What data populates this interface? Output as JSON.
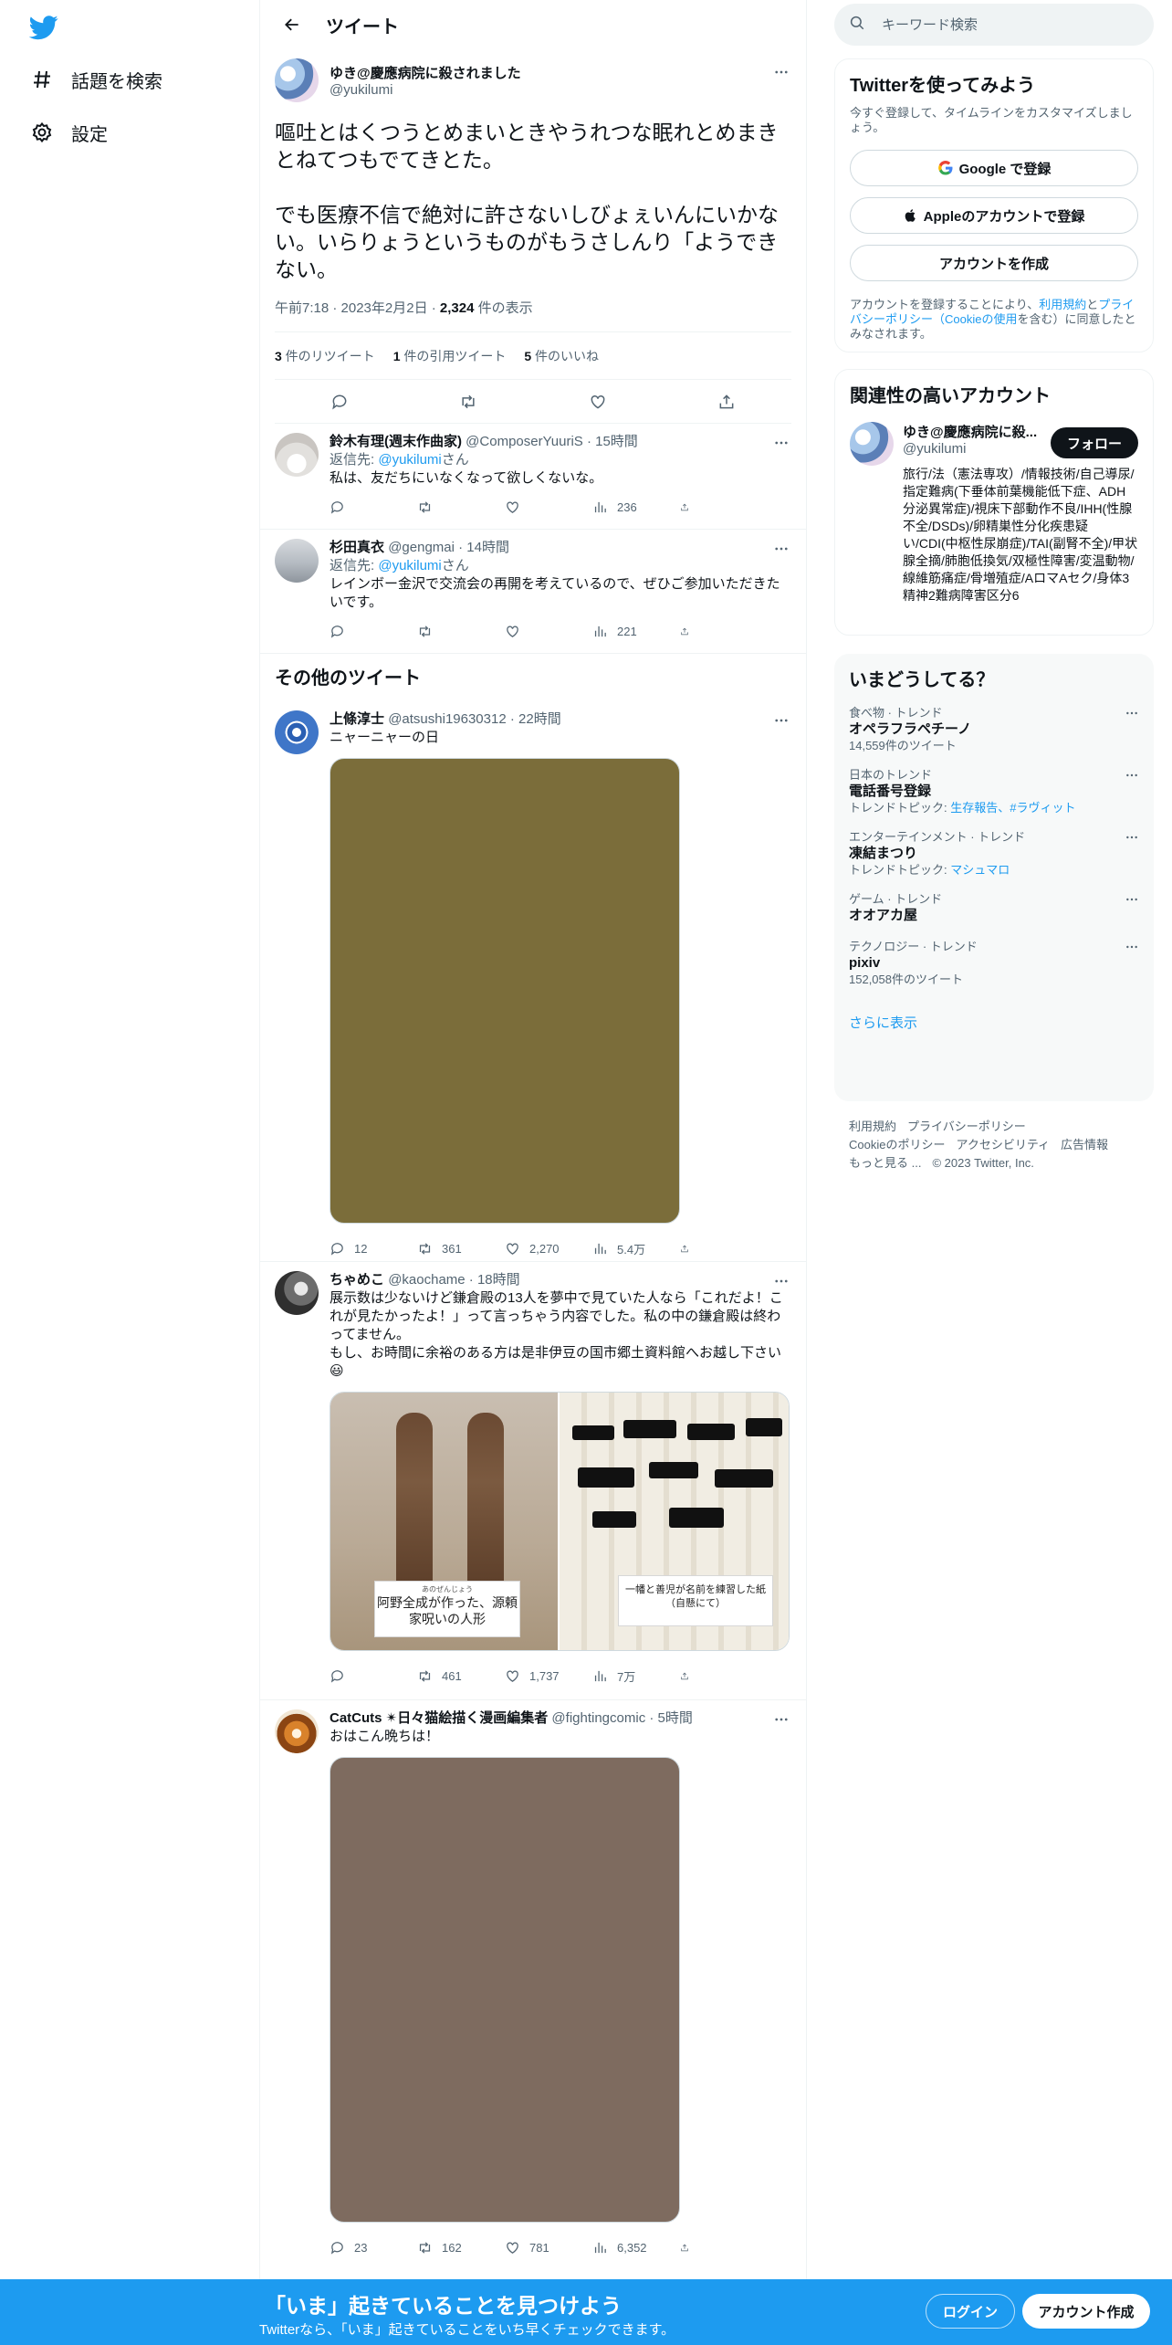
{
  "nav": {
    "explore_label": "話題を検索",
    "settings_label": "設定"
  },
  "header": {
    "title": "ツイート"
  },
  "focus_tweet": {
    "display_name": "ゆき@慶應病院に殺されました",
    "handle": "@yukilumi",
    "text": "嘔吐とはくつうとめまいときやうれつな眠れとめまきとねてつもでてきとた。\n\nでも医療不信で絶対に許さないしびょぇいんにいかない。いらりょうというものがもうさしんり「ようできない。",
    "time": "午前7:18 · 2023年2月2日 · ",
    "views": "2,324",
    "views_label": " 件の表示",
    "retweets": "3",
    "retweets_label": " 件のリツイート",
    "quotes": "1",
    "quotes_label": " 件の引用ツイート",
    "likes": "5",
    "likes_label": " 件のいいね"
  },
  "replies": [
    {
      "display_name": "鈴木有理(週末作曲家)",
      "handle_time": "@ComposerYuuriS · 15時間",
      "reply_prefix": "返信先: ",
      "reply_to": "@yukilumi",
      "reply_suffix": "さん",
      "text": "私は、友だちにいなくなって欲しくないな。",
      "views": "236"
    },
    {
      "display_name": "杉田真衣",
      "handle_time": "@gengmai · 14時間",
      "reply_prefix": "返信先: ",
      "reply_to": "@yukilumi",
      "reply_suffix": "さん",
      "text": "レインボー金沢で交流会の再開を考えているので、ぜひご参加いただきたいです。",
      "views": "221"
    }
  ],
  "more_tweets_title": "その他のツイート",
  "more_tweets": [
    {
      "display_name": "上條淳士",
      "handle_time": "@atsushi19630312 · 22時間",
      "text": "ニャーニャーの日",
      "media_color": "#7b6d3a",
      "replies": "12",
      "retweets": "361",
      "likes": "2,270",
      "views": "5.4万"
    },
    {
      "display_name": "ちゃめこ",
      "handle_time": "@kaochame · 18時間",
      "text": "展示数は少ないけど鎌倉殿の13人を夢中で見ていた人なら「これだよ！これが見たかったよ！」って言っちゃう内容でした。私の中の鎌倉殿は終わってません。\nもし、お時間に余裕のある方は是非伊豆の国市郷土資料館へお越し下さい😃",
      "caption_left_ruby": "あのぜんじょう",
      "caption_left": "阿野全成が作った、源頼家呪いの人形",
      "caption_right_small": "一幡と善児が名前を練習した紙",
      "caption_right": "（自懸にて）",
      "replies": "",
      "retweets": "461",
      "likes": "1,737",
      "views": "7万"
    },
    {
      "display_name": "CatCuts ✴日々猫絵描く漫画編集者",
      "handle_time": "@fightingcomic · 5時間",
      "text": "おはこん晩ちは！",
      "media_color": "#7e6b5f",
      "replies": "23",
      "retweets": "162",
      "likes": "781",
      "views": "6,352"
    }
  ],
  "search": {
    "placeholder": "キーワード検索"
  },
  "signup_card": {
    "title": "Twitterを使ってみよう",
    "desc": "今すぐ登録して、タイムラインをカスタマイズしましょう。",
    "google": "Google で登録",
    "apple": "Appleのアカウントで登録",
    "create": "アカウントを作成",
    "terms_pre": "アカウントを登録することにより、",
    "terms_link1": "利用規約",
    "terms_mid": "と",
    "terms_link2": "プライバシーポリシー（Cookieの使用",
    "terms_post": "を含む）に同意したとみなされます。"
  },
  "related": {
    "title": "関連性の高いアカウント",
    "display_name": "ゆき@慶應病院に殺...",
    "handle": "@yukilumi",
    "follow": "フォロー",
    "bio": "旅行/法（憲法専攻）/情報技術/自己導尿/指定難病(下垂体前葉機能低下症、ADH分泌異常症)/視床下部動作不良/IHH(性腺不全/DSDs)/卵精巣性分化疾患疑い/CDI(中枢性尿崩症)/TAI(副腎不全)/甲状腺全摘/肺胞低換気/双極性障害/変温動物/線維筋痛症/骨増殖症/AロマAセク/身体3精神2難病障害区分6"
  },
  "trends": {
    "title": "いまどうしてる？",
    "items": [
      {
        "category": "食べ物 · トレンド",
        "name": "オペラフラペチーノ",
        "extra": "14,559件のツイート"
      },
      {
        "category": "日本のトレンド",
        "name": "電話番号登録",
        "extra_prefix": "トレンドトピック: ",
        "extra_links": "生存報告、#ラヴィット"
      },
      {
        "category": "エンターテインメント · トレンド",
        "name": "凍結まつり",
        "extra_prefix": "トレンドトピック: ",
        "extra_links": "マシュマロ"
      },
      {
        "category": "ゲーム · トレンド",
        "name": "オオアカ屋"
      },
      {
        "category": "テクノロジー · トレンド",
        "name": "pixiv",
        "extra": "152,058件のツイート"
      }
    ],
    "show_more": "さらに表示"
  },
  "footer": {
    "terms": "利用規約",
    "privacy": "プライバシーポリシー",
    "cookie": "Cookieのポリシー",
    "accessibility": "アクセシビリティ",
    "ads": "広告情報",
    "more": "もっと見る ...",
    "copyright": "© 2023 Twitter, Inc."
  },
  "bottom_bar": {
    "title": "「いま」起きていることを見つけよう",
    "subtitle": "Twitterなら、「いま」起きていることをいち早くチェックできます。",
    "login": "ログイン",
    "signup": "アカウント作成"
  },
  "colors": {
    "accent": "#1d9bf0",
    "text": "#0f1419",
    "muted": "#536471"
  }
}
